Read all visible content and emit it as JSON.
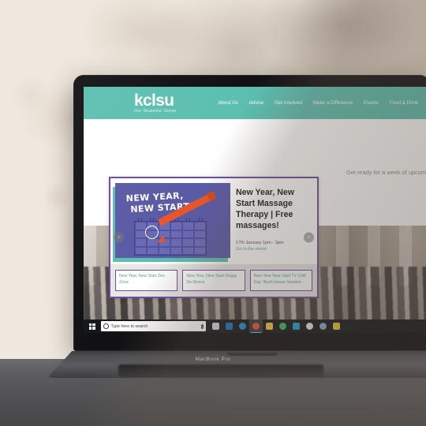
{
  "device": {
    "brand_label": "MacBook Pro"
  },
  "site": {
    "brand": {
      "name": "kclsu",
      "tagline": "Our Students' Union"
    },
    "nav": [
      {
        "label": "About Us"
      },
      {
        "label": "Advice"
      },
      {
        "label": "Get Involved"
      },
      {
        "label": "Make a Difference"
      },
      {
        "label": "Events"
      },
      {
        "label": "Food & Drink"
      }
    ],
    "side_copy": "Get ready for a week of upcoming events to loo",
    "carousel": {
      "prev_label": "‹",
      "next_label": "›",
      "poster": {
        "line1": "NEW YEAR,",
        "line2": "NEW START!"
      },
      "slide": {
        "title": "New Year, New Start Massage Therapy | Free massages!",
        "meta": "17th January 1pm - 3pm",
        "link": "Go to the event"
      },
      "thumbnails": [
        {
          "label": "New Year, New Start Zen Zone"
        },
        {
          "label": "New Year, New Start Doggy De-Stress"
        },
        {
          "label": "New Year New Start TV Chill Day: Bush House Session"
        }
      ]
    }
  },
  "taskbar": {
    "start_label": "Start",
    "search_placeholder": "Type here to search",
    "icons": [
      {
        "name": "task-view-icon",
        "color": "#cfd6dc"
      },
      {
        "name": "outlook-icon",
        "color": "#1b6fc4"
      },
      {
        "name": "edge-icon",
        "color": "#1f8ad6"
      },
      {
        "name": "chrome-icon",
        "color": "#e8503a",
        "active": true
      },
      {
        "name": "file-explorer-icon",
        "color": "#f0c24b"
      },
      {
        "name": "globe-icon",
        "color": "#35b76a"
      },
      {
        "name": "photos-icon",
        "color": "#1f9ec4"
      },
      {
        "name": "settings-icon",
        "color": "#e8e8e8"
      },
      {
        "name": "mail-app-icon",
        "color": "#7fa8c9"
      },
      {
        "name": "notes-icon",
        "color": "#e5c638"
      }
    ]
  },
  "colors": {
    "brand_teal": "#5cbfb0",
    "card_purple": "#6f4d9e",
    "poster_purple": "#5b5aa6",
    "accent_orange": "#e8562a",
    "link_teal": "#4aa79a"
  }
}
